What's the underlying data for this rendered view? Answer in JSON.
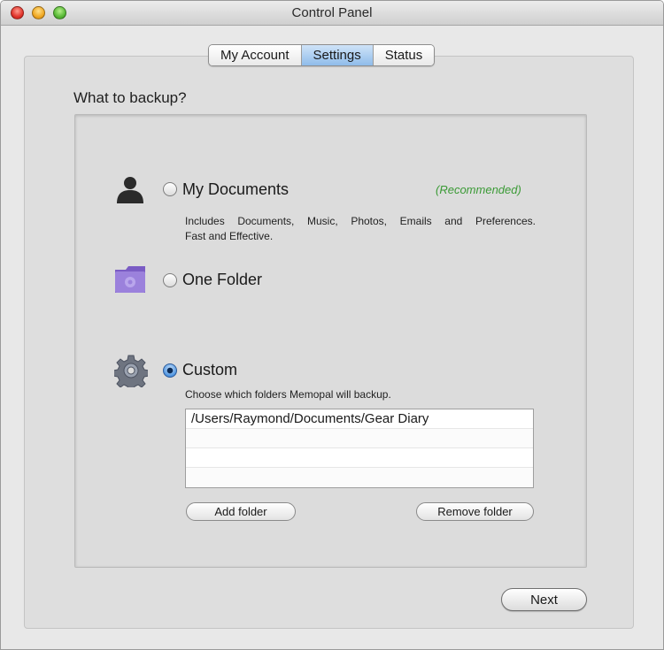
{
  "window": {
    "title": "Control Panel"
  },
  "tabs": [
    {
      "label": "My Account",
      "active": false
    },
    {
      "label": "Settings",
      "active": true
    },
    {
      "label": "Status",
      "active": false
    }
  ],
  "section": {
    "heading": "What to backup?"
  },
  "options": {
    "my_documents": {
      "label": "My Documents",
      "badge": "(Recommended)",
      "description_line1": "Includes Documents, Music, Photos, Emails and Preferences.",
      "description_line2": "Fast and Effective.",
      "selected": false,
      "icon": "person-silhouette-icon"
    },
    "one_folder": {
      "label": "One Folder",
      "selected": false,
      "icon": "purple-folder-icon"
    },
    "custom": {
      "label": "Custom",
      "description": "Choose which folders Memopal will backup.",
      "selected": true,
      "icon": "gear-icon"
    }
  },
  "folder_list": {
    "rows": [
      "/Users/Raymond/Documents/Gear Diary",
      "",
      "",
      ""
    ]
  },
  "buttons": {
    "add_folder": "Add folder",
    "remove_folder": "Remove folder",
    "next": "Next"
  },
  "colors": {
    "recommended": "#3a9a35",
    "active_tab": "#8fbcea",
    "folder_icon": "#8b6fd0"
  }
}
